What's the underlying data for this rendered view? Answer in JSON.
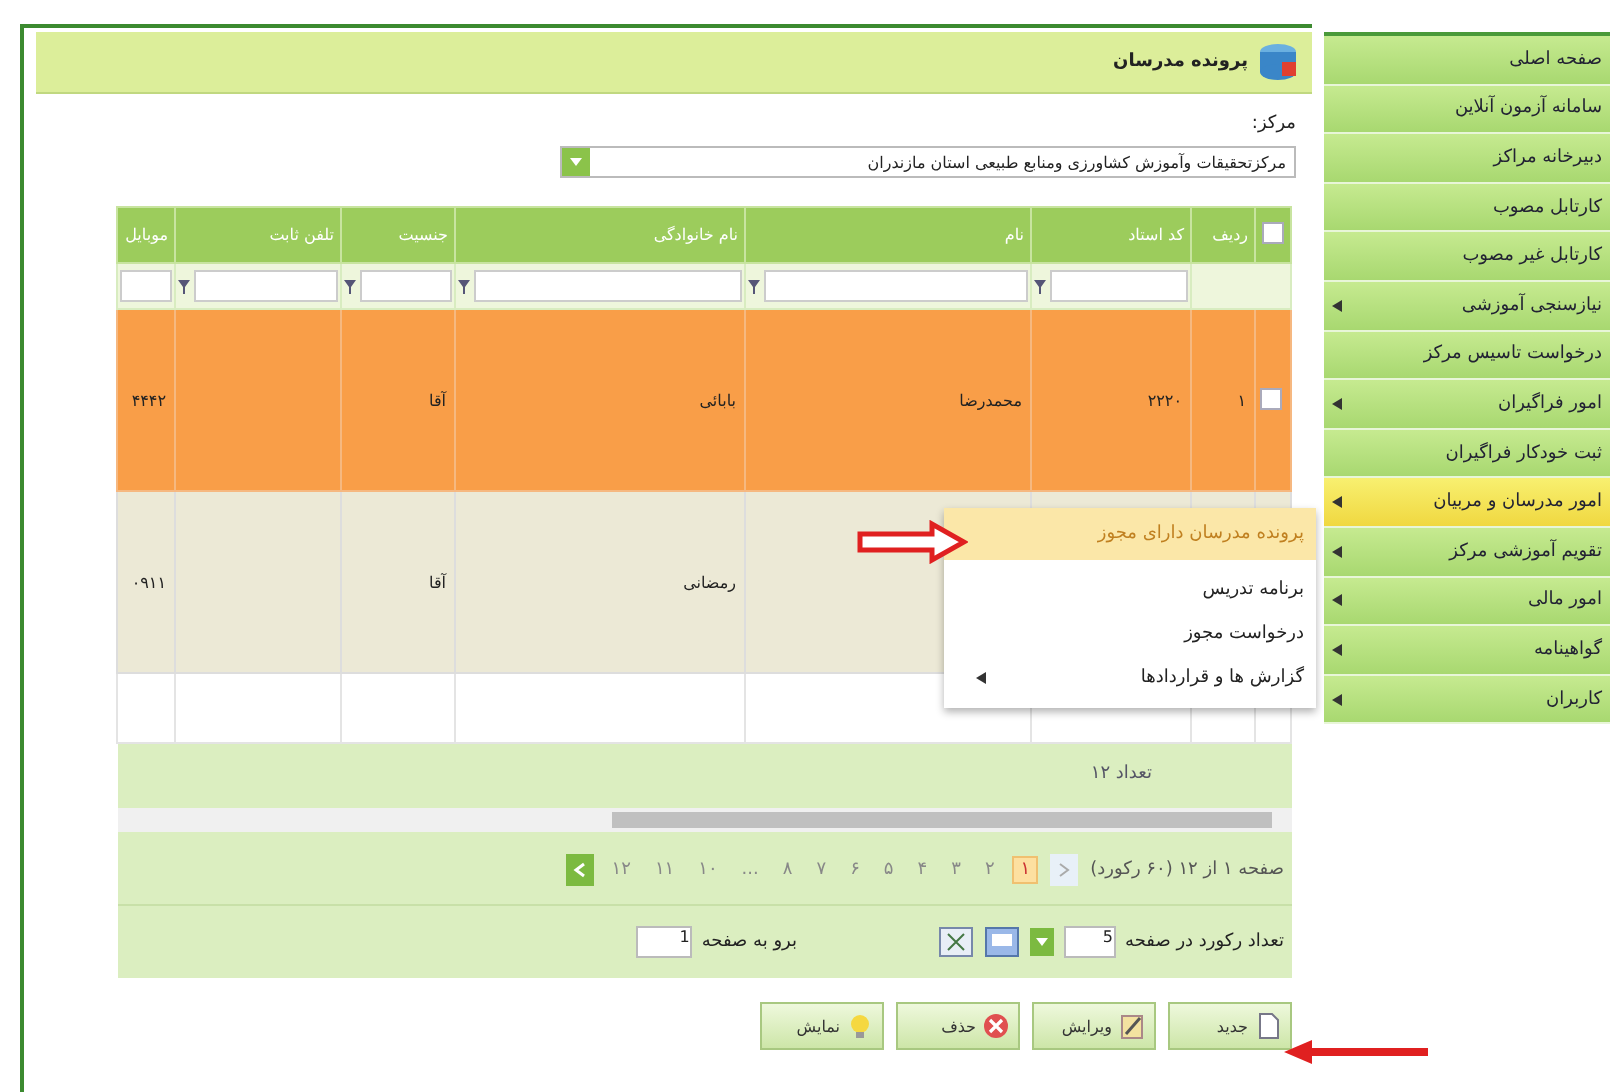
{
  "sidebar": {
    "items": [
      {
        "label": "صفحه اصلی",
        "has_submenu": false,
        "selected": false
      },
      {
        "label": "سامانه آزمون آنلاین",
        "has_submenu": false,
        "selected": false
      },
      {
        "label": "دبیرخانه مراکز",
        "has_submenu": false,
        "selected": false
      },
      {
        "label": "کارتابل مصوب",
        "has_submenu": false,
        "selected": false
      },
      {
        "label": "کارتابل غیر مصوب",
        "has_submenu": false,
        "selected": false
      },
      {
        "label": "نیازسنجی آموزشی",
        "has_submenu": true,
        "selected": false
      },
      {
        "label": "درخواست تاسیس مرکز",
        "has_submenu": false,
        "selected": false
      },
      {
        "label": "امور فراگیران",
        "has_submenu": true,
        "selected": false
      },
      {
        "label": "ثبت خودکار فراگیران",
        "has_submenu": false,
        "selected": false
      },
      {
        "label": "امور مدرسان و مربیان",
        "has_submenu": true,
        "selected": true
      },
      {
        "label": "تقویم آموزشی مرکز",
        "has_submenu": true,
        "selected": false
      },
      {
        "label": "امور مالی",
        "has_submenu": true,
        "selected": false
      },
      {
        "label": "گواهینامه",
        "has_submenu": true,
        "selected": false
      },
      {
        "label": "کاربران",
        "has_submenu": true,
        "selected": false
      }
    ]
  },
  "panel": {
    "title": "پرونده مدرسان",
    "center_label": "مرکز:",
    "center_value": "مرکزتحقیقات وآموزش کشاورزی ومنابع طبیعی استان مازندران"
  },
  "table": {
    "all_checked": false,
    "columns": [
      "ردیف",
      "کد استاد",
      "نام",
      "نام خانوادگی",
      "جنسیت",
      "تلفن ثابت",
      "موبایل"
    ],
    "rows": [
      {
        "selected": true,
        "checked": false,
        "cells": [
          "۱",
          "۲۲۲۰",
          "محمدرضا",
          "بابائی",
          "آقا",
          null,
          "۴۴۴۲"
        ]
      },
      {
        "selected": false,
        "cells": [
          null,
          null,
          null,
          "رمضانی",
          "آقا",
          null,
          "۰۹۱۱"
        ]
      }
    ],
    "total": "تعداد ۱۲",
    "pager_info": "صفحه ۱ از ۱۲ (۶۰ رکورد)",
    "pages": [
      {
        "label": "۱",
        "selected": true
      },
      {
        "label": "۲",
        "selected": false
      },
      {
        "label": "۳",
        "selected": false
      },
      {
        "label": "۴",
        "selected": false
      },
      {
        "label": "۵",
        "selected": false
      },
      {
        "label": "۶",
        "selected": false
      },
      {
        "label": "۷",
        "selected": false
      },
      {
        "label": "۸",
        "selected": false
      },
      {
        "label": "...",
        "selected": false
      },
      {
        "label": "۱۰",
        "selected": false
      },
      {
        "label": "۱۱",
        "selected": false
      },
      {
        "label": "۱۲",
        "selected": false
      }
    ],
    "page_size_label": "تعداد رکورد در صفحه",
    "page_size": "5",
    "goto_label": "برو به صفحه",
    "goto_value": "1"
  },
  "context_menu": {
    "items": [
      {
        "label": "پرونده مدرسان دارای مجوز",
        "selected": true,
        "has_submenu": false
      },
      {
        "label": "برنامه تدریس",
        "selected": false,
        "has_submenu": false
      },
      {
        "label": "درخواست مجوز",
        "selected": false,
        "has_submenu": false
      },
      {
        "label": "گزارش ها و قراردادها",
        "selected": false,
        "has_submenu": true
      }
    ]
  },
  "buttons": [
    "جدید",
    "ویرایش",
    "حذف",
    "نمایش"
  ]
}
